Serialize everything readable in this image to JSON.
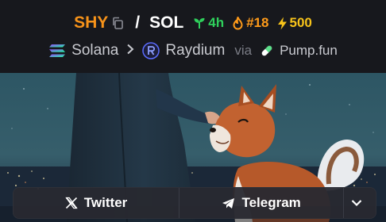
{
  "pair": {
    "base_symbol": "SHY",
    "separator": "/",
    "quote_symbol": "SOL",
    "age": "4h",
    "rank": "#18",
    "boosts": "500"
  },
  "route": {
    "chain": "Solana",
    "dex": "Raydium",
    "via_label": "via",
    "launchpad": "Pump.fun"
  },
  "links": {
    "twitter_label": "Twitter",
    "telegram_label": "Telegram"
  },
  "colors": {
    "base": "#f7931a",
    "age": "#2fd05c",
    "rank": "#ff9b1a",
    "boost": "#f7c31a",
    "background": "#17181d"
  },
  "icons": [
    "copy-icon",
    "sprout-icon",
    "flame-icon",
    "bolt-icon",
    "solana-icon",
    "chevron-right-icon",
    "raydium-icon",
    "pill-icon",
    "x-logo-icon",
    "telegram-icon",
    "chevron-down-icon"
  ]
}
